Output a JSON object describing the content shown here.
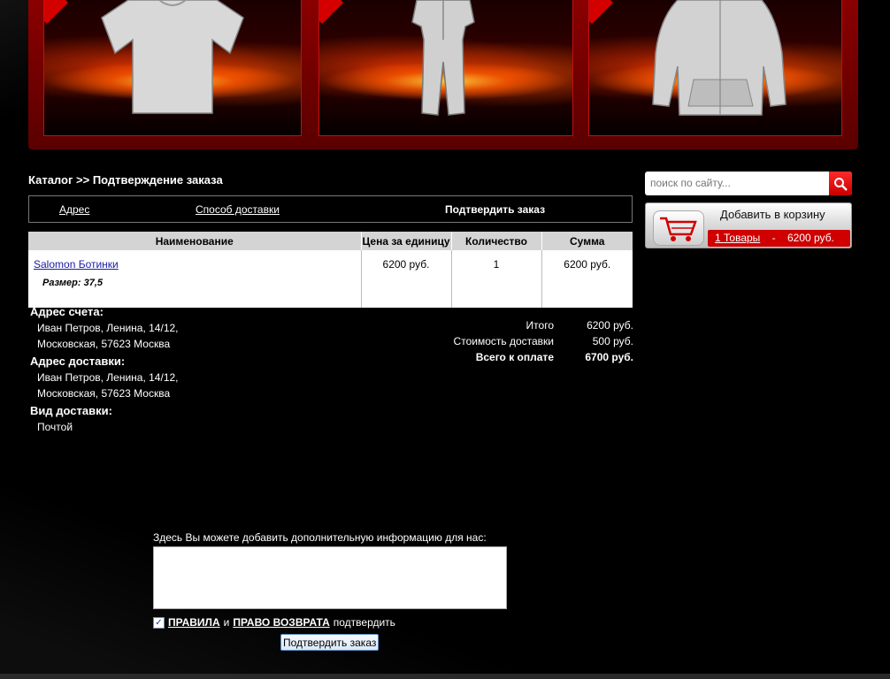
{
  "breadcrumb": {
    "catalog": "Каталог",
    "separator": ">>",
    "current": "Подтверждение заказа"
  },
  "steps": {
    "address": "Адрес",
    "shipping": "Способ доставки",
    "confirm": "Подтвердить заказ"
  },
  "order_table": {
    "headers": [
      "Наименование",
      "Цена за единицу",
      "Количество",
      "Сумма"
    ],
    "rows": [
      {
        "name": "Salomon Ботинки",
        "size": "Размер: 37,5",
        "price": "6200 руб.",
        "qty": "1",
        "sum": "6200 руб."
      }
    ]
  },
  "billing": {
    "title": "Адрес счета:",
    "line1": "Иван Петров, Ленина, 14/12,",
    "line2": "Московская, 57623 Москва"
  },
  "shipping": {
    "title": "Адрес доставки:",
    "line1": "Иван Петров, Ленина, 14/12,",
    "line2": "Московская, 57623 Москва"
  },
  "delivery": {
    "title": "Вид доставки:",
    "method": "Почтой"
  },
  "totals": {
    "subtotal_label": "Итого",
    "subtotal": "6200 руб.",
    "shipping_label": "Стоимость доставки",
    "shipping": "500 руб.",
    "total_label": "Всего к оплате",
    "total": "6700 руб."
  },
  "comment": {
    "label": "Здесь Вы можете добавить дополнительную информацию для нас:",
    "value": ""
  },
  "agreement": {
    "checked": true,
    "rules": "ПРАВИЛА",
    "and": "и",
    "returns": "ПРАВО ВОЗВРАТА",
    "confirm_text": "подтвердить"
  },
  "confirm_button": "Подтвердить заказ",
  "search": {
    "placeholder": "поиск по сайту..."
  },
  "cart": {
    "title": "Добавить в корзину",
    "items": "1 Товары",
    "dash": "-",
    "total": "6200 руб."
  },
  "colors": {
    "accent": "#d00000",
    "background": "#000000",
    "link": "#1a1aa6"
  },
  "icons": [
    "search-icon",
    "cart-icon",
    "checkbox-checked-icon"
  ]
}
